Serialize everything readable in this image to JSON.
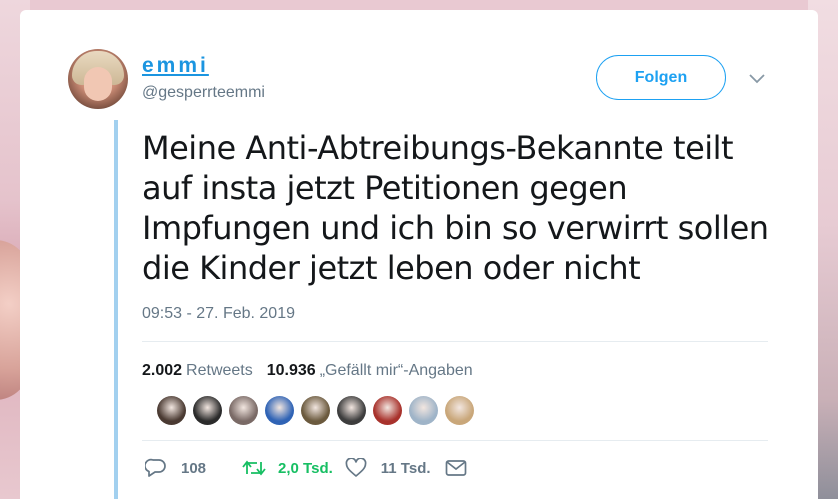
{
  "user": {
    "display_name": "emmi",
    "handle": "@gesperrteemmi"
  },
  "follow_button": {
    "label": "Folgen"
  },
  "tweet": {
    "text_lines": [
      "Meine Anti-Abtreibungs-Bekannte teilt",
      "auf insta jetzt Petitionen gegen",
      "Impfungen und ich bin so verwirrt sollen",
      "die Kinder jetzt leben oder nicht"
    ],
    "timestamp": "09:53 - 27. Feb. 2019"
  },
  "stats": {
    "retweets_count": "2.002",
    "retweets_label": "Retweets",
    "likes_count": "10.936",
    "likes_label": "„Gefällt mir“-Angaben"
  },
  "likers": [
    {
      "color": "#4a3a32"
    },
    {
      "color": "#2b2b2b"
    },
    {
      "color": "#7a6a66"
    },
    {
      "color": "#2f63b5"
    },
    {
      "color": "#6b5a3e"
    },
    {
      "color": "#3d3d3d"
    },
    {
      "color": "#a8322c"
    },
    {
      "color": "#9fb4c8"
    },
    {
      "color": "#c9a77a"
    }
  ],
  "actions": {
    "reply_count": "108",
    "retweet_count": "2,0 Tsd.",
    "like_count": "11 Tsd."
  },
  "colors": {
    "accent": "#1da1f2",
    "link": "#1b95e0",
    "retweet_green": "#17bf63",
    "muted": "#657786",
    "thread_line": "#a2d0ef"
  },
  "icons": [
    "chevron-down-icon",
    "reply-icon",
    "retweet-icon",
    "heart-icon",
    "message-icon"
  ]
}
